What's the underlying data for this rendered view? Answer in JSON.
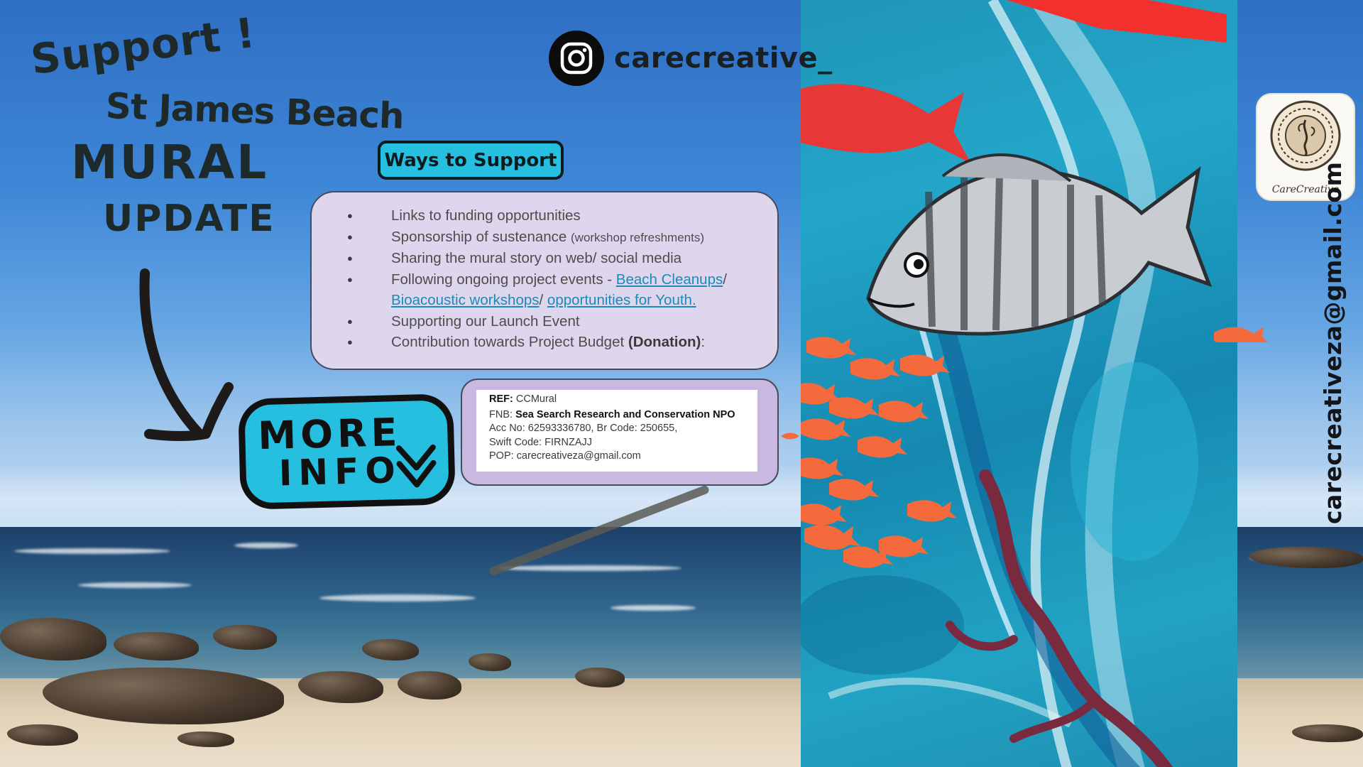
{
  "headline": {
    "line1": "Support !",
    "line2": "St James Beach",
    "line3": "MURAL",
    "line4": "UPDATE"
  },
  "instagram": {
    "icon": "instagram-icon",
    "handle": "carecreative_"
  },
  "ways_badge": "Ways to Support",
  "support_list": {
    "item1": "Links to funding opportunities",
    "item2_main": "Sponsorship of sustenance ",
    "item2_small": "(workshop refreshments)",
    "item3": "Sharing the mural story on web/ social media",
    "item4_prefix": "Following ongoing project events  -  ",
    "item4_link1": "Beach Cleanups",
    "item4_sep1": "/",
    "item4_link2": "Bioacoustic workshops",
    "item4_sep2": "/ ",
    "item4_link3": "opportunities for Youth.",
    "item5": "Supporting our Launch Event",
    "item6_prefix": "Contribution towards Project Budget ",
    "item6_bold": "(Donation)",
    "item6_suffix": ":"
  },
  "bank": {
    "ref_label": "REF:",
    "ref_value": " CCMural",
    "fnb_label": "FNB: ",
    "fnb_value": "Sea Search Research and Conservation NPO",
    "acc_line": "Acc No:  62593336780, Br Code: 250655,",
    "swift_line": "Swift Code:  FIRNZAJJ",
    "pop_line": " POP: carecreativeza@gmail.com"
  },
  "more_info": {
    "line1": "MORE",
    "line2": "INFO",
    "icon": "double-chevron-down-icon"
  },
  "logo": {
    "caption": "CareCreative"
  },
  "email_vertical": "carecreativeza@gmail.com",
  "colors": {
    "badge_cyan": "#27bfe0",
    "box_lilac": "#ddd6ec",
    "card_lilac": "#c9b9e0",
    "link_blue": "#1d8ab8",
    "fish_red": "#f2312e",
    "fish_orange": "#f56a3d"
  }
}
